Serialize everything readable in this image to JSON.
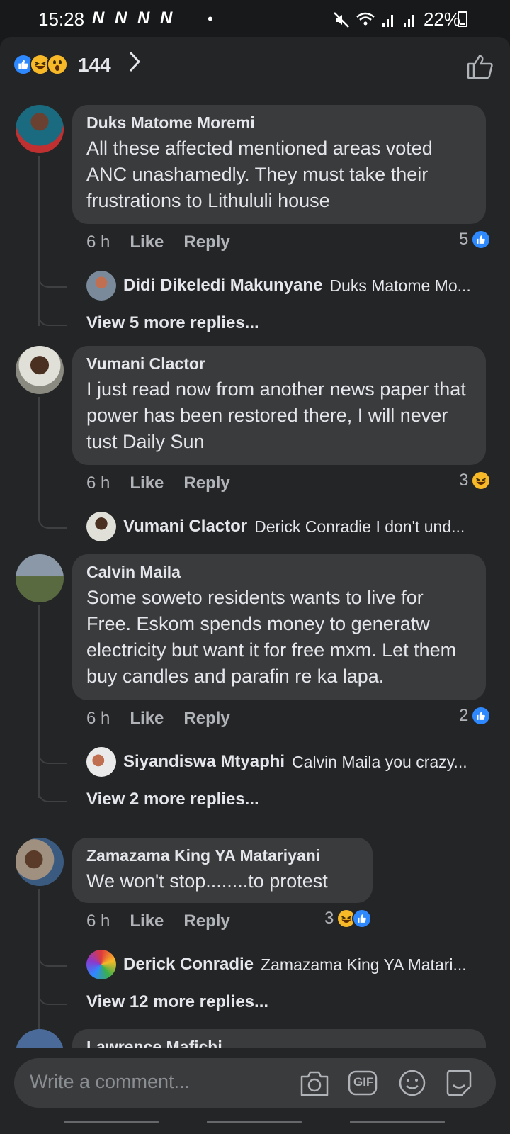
{
  "status_bar": {
    "time": "15:28",
    "notification_icons": "N N N N",
    "battery": "22%"
  },
  "header": {
    "reaction_count": "144",
    "reaction_icons": [
      "like-icon",
      "haha-icon",
      "wow-icon"
    ]
  },
  "comments": [
    {
      "author": "Duks Matome Moremi",
      "text": "All these affected mentioned areas voted ANC unashamedly. They must take their frustrations to Lithululi house",
      "time": "6 h",
      "like_label": "Like",
      "reply_label": "Reply",
      "reaction_count": "5",
      "reply": {
        "author": "Didi Dikeledi Makunyane",
        "text": "Duks Matome Mo..."
      },
      "more_replies": "View 5 more replies..."
    },
    {
      "author": "Vumani Clactor",
      "text": "I just read now from another news paper that power has been restored there, I will never tust Daily Sun",
      "time": "6 h",
      "like_label": "Like",
      "reply_label": "Reply",
      "reaction_count": "3",
      "reply": {
        "author": "Vumani Clactor",
        "text": "Derick Conradie I don't und..."
      }
    },
    {
      "author": "Calvin Maila",
      "text": "Some soweto residents wants to live for Free. Eskom spends money to generatw electricity but want it for free mxm. Let them buy candles and parafin re ka lapa.",
      "time": "6 h",
      "like_label": "Like",
      "reply_label": "Reply",
      "reaction_count": "2",
      "reply": {
        "author": "Siyandiswa Mtyaphi",
        "text": "Calvin Maila  you crazy..."
      },
      "more_replies": "View 2 more replies..."
    },
    {
      "author": "Zamazama King YA Matariyani",
      "text": "We won't stop........to protest",
      "time": "6 h",
      "like_label": "Like",
      "reply_label": "Reply",
      "reaction_count": "3",
      "reply": {
        "author": "Derick Conradie",
        "text": "Zamazama King YA Matari..."
      },
      "more_replies": "View 12 more replies..."
    },
    {
      "author": "Lawrence Mafichi"
    }
  ],
  "composer": {
    "placeholder": "Write a comment...",
    "gif_label": "GIF"
  }
}
